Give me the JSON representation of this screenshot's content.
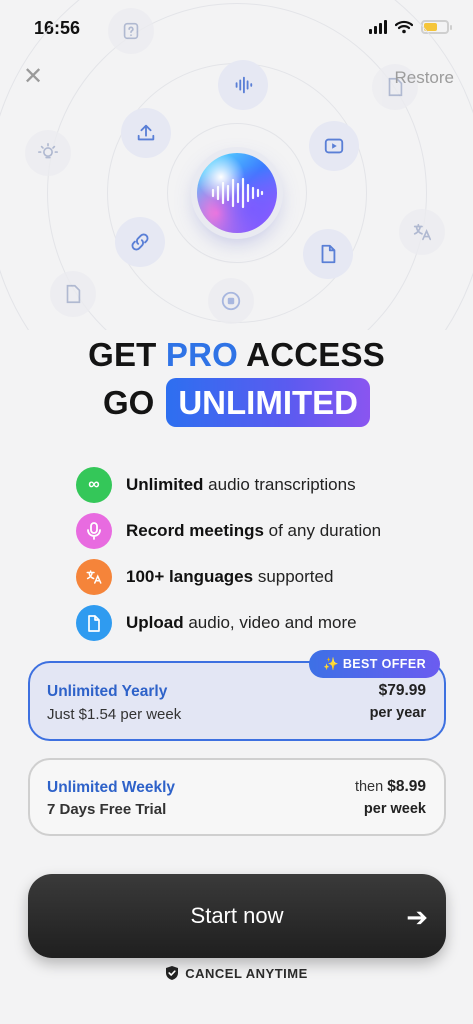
{
  "status_bar": {
    "time": "16:56"
  },
  "header": {
    "close_glyph": "✕",
    "restore_label": "Restore"
  },
  "hero": {
    "icons": [
      "audio-wave-icon",
      "upload-icon",
      "play-video-icon",
      "link-icon",
      "document-icon",
      "stop-icon",
      "lightbulb-icon",
      "translate-icon",
      "doc-icon",
      "pdf-icon",
      "question-icon"
    ]
  },
  "headline": {
    "line1_prefix": "GET",
    "line1_highlight": "PRO",
    "line1_suffix": "ACCESS",
    "line2_prefix": "GO",
    "line2_pill": "UNLIMITED"
  },
  "features": [
    {
      "icon": "infinity-icon",
      "color": "#34c759",
      "glyph": "∞",
      "bold": "Unlimited",
      "rest": " audio transcriptions"
    },
    {
      "icon": "microphone-icon",
      "color": "#e86be0",
      "glyph": "🎙",
      "bold": "Record meetings",
      "rest": " of any duration"
    },
    {
      "icon": "translate-icon",
      "color": "#f5843a",
      "glyph": "文",
      "bold": "100+ languages",
      "rest": " supported"
    },
    {
      "icon": "file-icon",
      "color": "#2f9bf0",
      "glyph": "▢",
      "bold": "Upload",
      "rest": " audio, video and more"
    }
  ],
  "plans": {
    "badge": "✨ BEST OFFER",
    "yearly": {
      "name": "Unlimited Yearly",
      "sub": "Just $1.54 per week",
      "price": "$79.99",
      "per": "per year"
    },
    "weekly": {
      "name": "Unlimited Weekly",
      "sub": "7 Days Free Trial",
      "then": "then ",
      "price": "$8.99",
      "per": "per week"
    }
  },
  "cta": {
    "label": "Start now",
    "arrow": "➔"
  },
  "footer": {
    "cancel_label": "CANCEL ANYTIME"
  },
  "colors": {
    "accent": "#2f73e6",
    "pill_start": "#2d6ff0",
    "pill_end": "#8a55f0",
    "button": "#242424"
  }
}
